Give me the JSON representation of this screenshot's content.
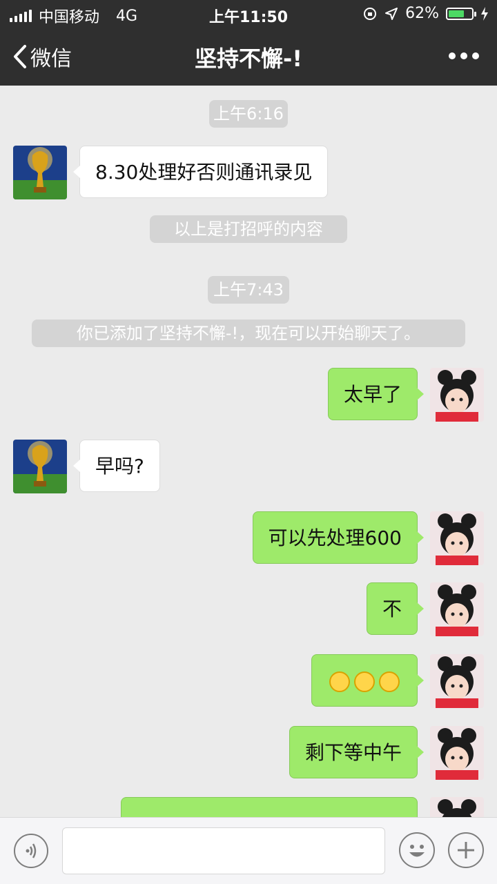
{
  "status_bar": {
    "carrier": "中国移动",
    "network": "4G",
    "time": "上午11:50",
    "battery": "62%"
  },
  "nav": {
    "back_label": "微信",
    "title": "坚持不懈-!"
  },
  "messages": {
    "ts1": "上午6:16",
    "m1": "8.30处理好否则通讯录见",
    "sys1": "以上是打招呼的内容",
    "ts2": "上午7:43",
    "sys2": "你已添加了坚持不懈-!，现在可以开始聊天了。",
    "m2": "太早了",
    "m3": "早吗?",
    "m4": "可以先处理600",
    "m5": "不",
    "m6_emoji": "smiley-emoji x3",
    "m7": "剩下等中午"
  },
  "icons": {
    "back": "chevron-left-icon",
    "more": "more-dots-icon",
    "voice": "voice-icon",
    "emoji": "emoji-icon",
    "plus": "plus-icon",
    "trophy_avatar": "trophy-avatar",
    "girl_avatar": "girl-avatar"
  },
  "colors": {
    "bar": "#2f2f2f",
    "chat_bg": "#ebebeb",
    "outgoing_bubble": "#9eea6a",
    "incoming_bubble": "#ffffff",
    "battery": "#4cd964"
  }
}
